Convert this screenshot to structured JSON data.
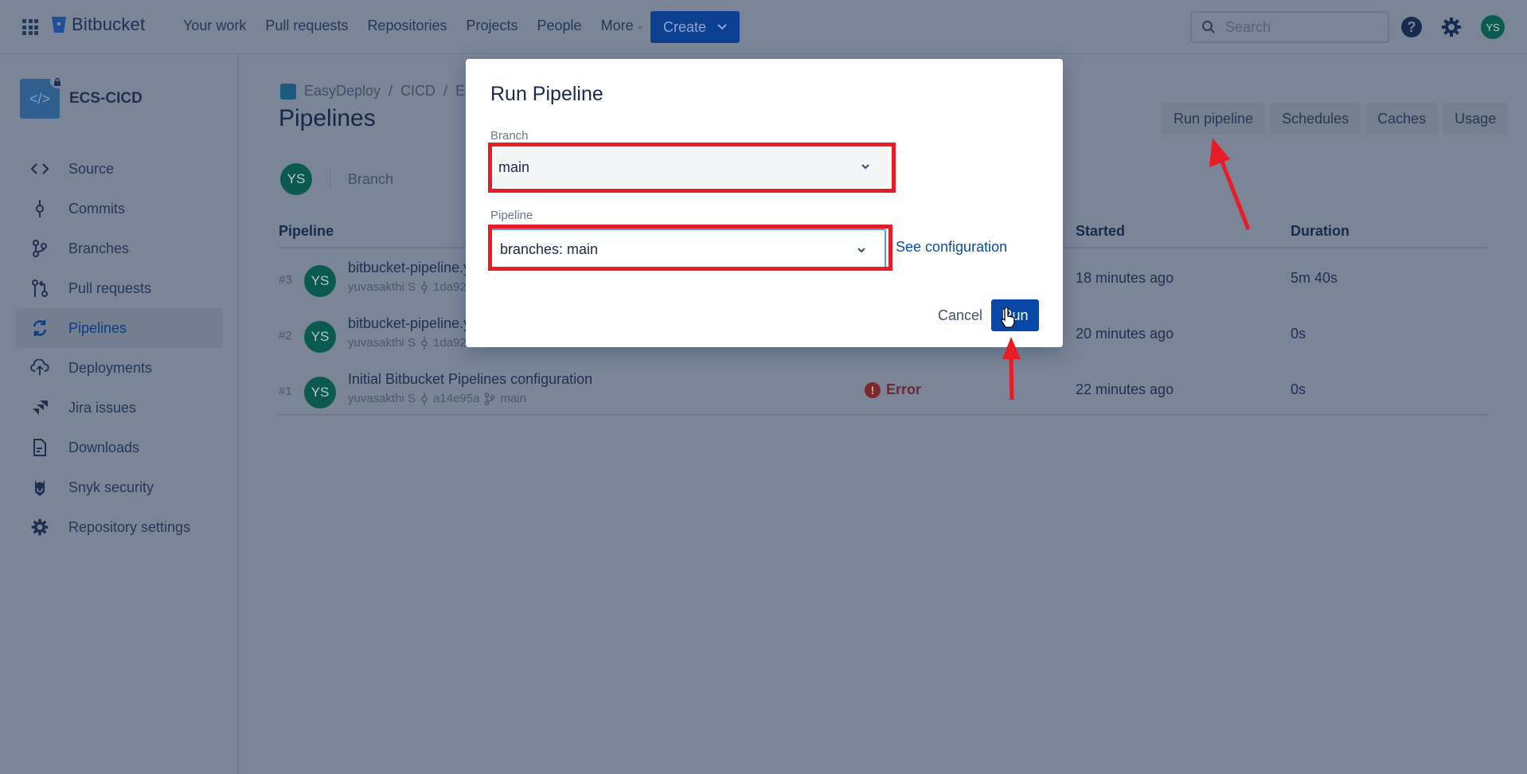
{
  "topbar": {
    "brand": "Bitbucket",
    "nav": [
      {
        "label": "Your work"
      },
      {
        "label": "Pull requests"
      },
      {
        "label": "Repositories"
      },
      {
        "label": "Projects"
      },
      {
        "label": "People"
      },
      {
        "label": "More",
        "has_dropdown": true
      }
    ],
    "create_label": "Create",
    "search_placeholder": "Search",
    "user_initials": "YS",
    "icons": [
      "apps-grid-icon",
      "bitbucket-logo-icon",
      "search-icon",
      "help-icon",
      "gear-icon"
    ]
  },
  "sidebar": {
    "repo_name": "ECS-CICD",
    "repo_private": true,
    "items": [
      {
        "label": "Source",
        "icon": "code-icon"
      },
      {
        "label": "Commits",
        "icon": "commit-icon"
      },
      {
        "label": "Branches",
        "icon": "branch-icon"
      },
      {
        "label": "Pull requests",
        "icon": "pull-request-icon"
      },
      {
        "label": "Pipelines",
        "icon": "pipelines-icon",
        "active": true
      },
      {
        "label": "Deployments",
        "icon": "cloud-upload-icon"
      },
      {
        "label": "Jira issues",
        "icon": "jira-icon"
      },
      {
        "label": "Downloads",
        "icon": "file-icon"
      },
      {
        "label": "Snyk security",
        "icon": "snyk-icon"
      },
      {
        "label": "Repository settings",
        "icon": "gear-icon"
      }
    ]
  },
  "main": {
    "breadcrumb": [
      "EasyDeploy",
      "CICD",
      "EC"
    ],
    "page_title": "Pipelines",
    "toolbar": {
      "run_pipeline": "Run pipeline",
      "schedules": "Schedules",
      "caches": "Caches",
      "usage": "Usage"
    },
    "filter": {
      "avatar_initials": "YS",
      "branch_label": "Branch"
    },
    "table": {
      "headers": {
        "pipeline": "Pipeline",
        "started": "Started",
        "duration": "Duration"
      },
      "rows": [
        {
          "num": "#3",
          "initials": "YS",
          "title": "bitbucket-pipeline.y",
          "author": "yuvasakthi S",
          "commit": "1da92",
          "branch": "",
          "status": "",
          "started": "18 minutes ago",
          "duration": "5m 40s"
        },
        {
          "num": "#2",
          "initials": "YS",
          "title": "bitbucket-pipeline.y",
          "author": "yuvasakthi S",
          "commit": "1da92",
          "branch": "",
          "status": "",
          "started": "20 minutes ago",
          "duration": "0s"
        },
        {
          "num": "#1",
          "initials": "YS",
          "title": "Initial Bitbucket Pipelines configuration",
          "author": "yuvasakthi S",
          "commit": "a14e95a",
          "branch": "main",
          "status": "Error",
          "started": "22 minutes ago",
          "duration": "0s"
        }
      ]
    }
  },
  "modal": {
    "title": "Run Pipeline",
    "branch_label": "Branch",
    "branch_value": "main",
    "pipeline_label": "Pipeline",
    "pipeline_value": "branches: main",
    "see_configuration": "See configuration",
    "cancel": "Cancel",
    "run": "Run"
  },
  "colors": {
    "accent": "#0747a6",
    "annotation_red": "#e81c24",
    "error": "#7a2a2a",
    "avatar": "#0b5a50"
  }
}
